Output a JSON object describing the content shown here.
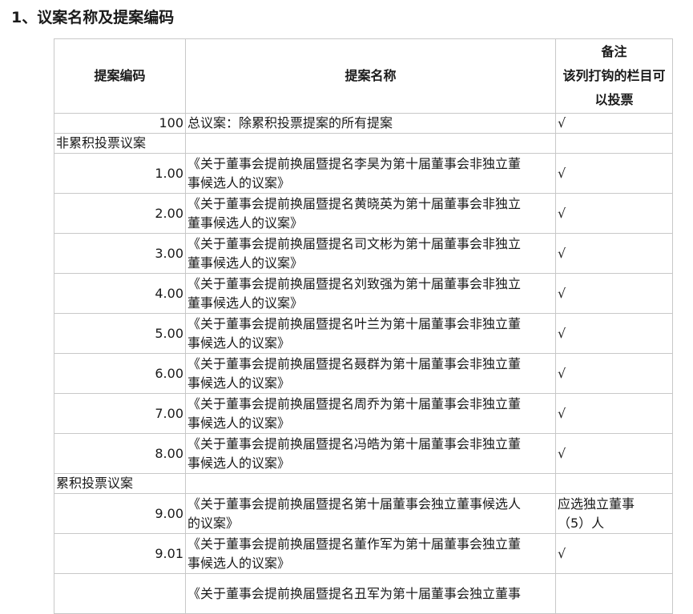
{
  "heading": "1、议案名称及提案编码",
  "table": {
    "headers": {
      "code": "提案编码",
      "name": "提案名称",
      "note_title": "备注",
      "note_line1": "该列打钩的栏目可",
      "note_line2": "以投票"
    },
    "total_row": {
      "code": "100",
      "name": "总议案：除累积投票提案的所有提案",
      "note": "√"
    },
    "section_noncumulative": "非累积投票议案",
    "noncumulative_rows": [
      {
        "code": "1.00",
        "name_line1": "《关于董事会提前换届暨提名李昊为第十届董事会非独立董",
        "name_line2": "事候选人的议案》",
        "note": "√"
      },
      {
        "code": "2.00",
        "name_line1": "《关于董事会提前换届暨提名黄晓英为第十届董事会非独立",
        "name_line2": "董事候选人的议案》",
        "note": "√"
      },
      {
        "code": "3.00",
        "name_line1": "《关于董事会提前换届暨提名司文彬为第十届董事会非独立",
        "name_line2": "董事候选人的议案》",
        "note": "√"
      },
      {
        "code": "4.00",
        "name_line1": "《关于董事会提前换届暨提名刘致强为第十届董事会非独立",
        "name_line2": "董事候选人的议案》",
        "note": "√"
      },
      {
        "code": "5.00",
        "name_line1": "《关于董事会提前换届暨提名叶兰为第十届董事会非独立董",
        "name_line2": "事候选人的议案》",
        "note": "√"
      },
      {
        "code": "6.00",
        "name_line1": "《关于董事会提前换届暨提名聂群为第十届董事会非独立董",
        "name_line2": "事候选人的议案》",
        "note": "√"
      },
      {
        "code": "7.00",
        "name_line1": "《关于董事会提前换届暨提名周乔为第十届董事会非独立董",
        "name_line2": "事候选人的议案》",
        "note": "√"
      },
      {
        "code": "8.00",
        "name_line1": "《关于董事会提前换届暨提名冯皓为第十届董事会非独立董",
        "name_line2": "事候选人的议案》",
        "note": "√"
      }
    ],
    "section_cumulative": "累积投票议案",
    "cumulative_rows": [
      {
        "code": "9.00",
        "name_line1": "《关于董事会提前换届暨提名第十届董事会独立董事候选人",
        "name_line2": "的议案》",
        "note_line1": "应选独立董事",
        "note_line2": "（5）人"
      },
      {
        "code": "9.01",
        "name_line1": "《关于董事会提前换届暨提名董作军为第十届董事会独立董",
        "name_line2": "事候选人的议案》",
        "note_line1": "√",
        "note_line2": ""
      },
      {
        "code": "",
        "name_line1": "《关于董事会提前换届暨提名丑军为第十届董事会独立董事",
        "name_line2": "",
        "note_line1": "",
        "note_line2": ""
      }
    ]
  }
}
